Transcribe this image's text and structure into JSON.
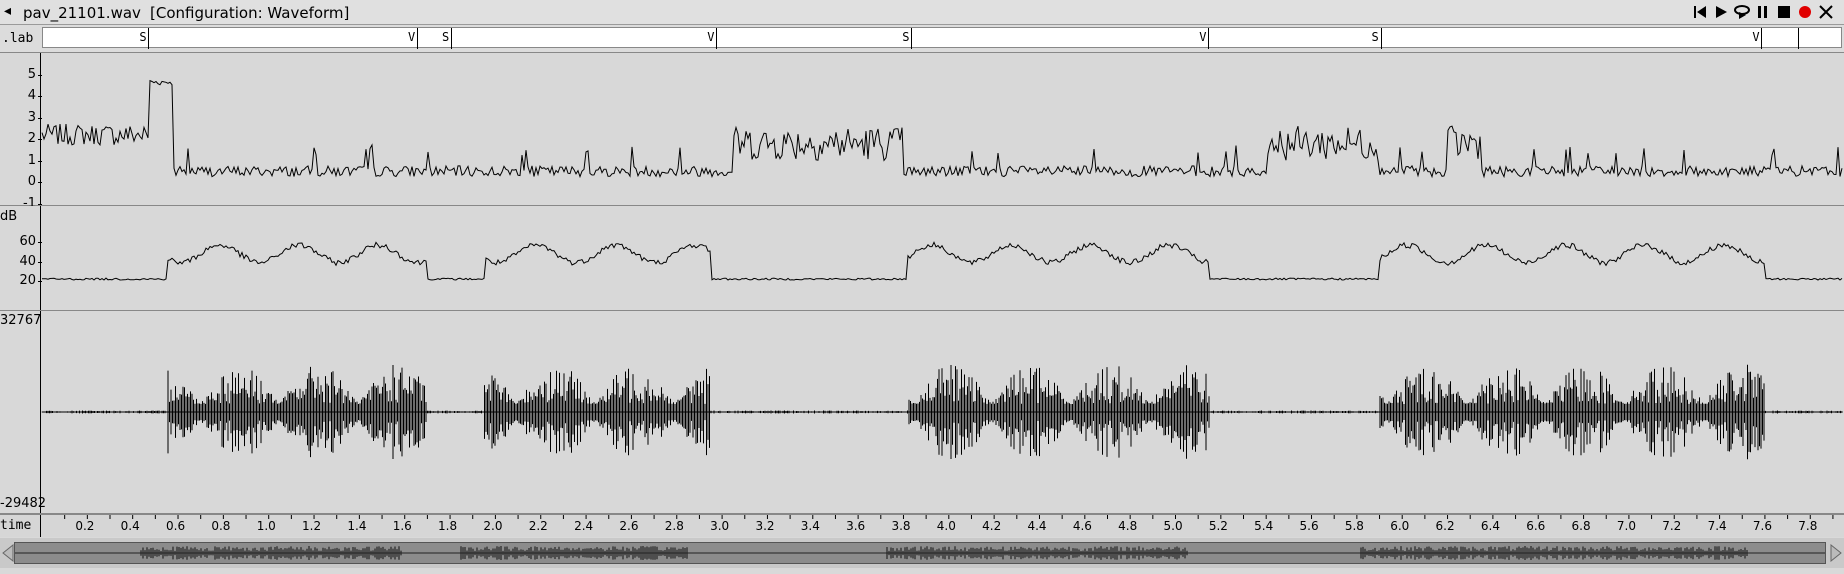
{
  "window": {
    "filename": "pav_21101.wav",
    "configuration": "[Configuration: Waveform]"
  },
  "toolbar": {
    "buttons": [
      "skip-to-start-icon",
      "play-icon",
      "loop-play-icon",
      "pause-icon",
      "stop-icon",
      "record-icon",
      "close-icon"
    ],
    "record_color": "#e00000"
  },
  "label_tier": {
    "name": ".lab",
    "labels": [
      {
        "text": "S",
        "time": 0.465
      },
      {
        "text": "V",
        "time": 1.65
      },
      {
        "text": "S",
        "time": 1.8
      },
      {
        "text": "V",
        "time": 2.97
      },
      {
        "text": "S",
        "time": 3.83
      },
      {
        "text": "V",
        "time": 5.14
      },
      {
        "text": "S",
        "time": 5.9
      },
      {
        "text": "V",
        "time": 7.58
      },
      {
        "text": "",
        "time": 7.74
      }
    ]
  },
  "pitch_pane": {
    "tick_labels": [
      "5",
      "4",
      "3",
      "2",
      "1",
      "0",
      "-1"
    ],
    "tick_values": [
      5,
      4,
      3,
      2,
      1,
      0,
      -1
    ]
  },
  "energy_pane": {
    "unit": "dB",
    "tick_labels": [
      "60",
      "40",
      "20"
    ],
    "tick_values": [
      60,
      40,
      20
    ]
  },
  "waveform_pane": {
    "max_label": "32767",
    "min_label": "-29482"
  },
  "time_axis": {
    "label": "time",
    "start": 0.0,
    "end": 7.94,
    "tick_labels": [
      "0.2",
      "0.4",
      "0.6",
      "0.8",
      "1.0",
      "1.2",
      "1.4",
      "1.6",
      "1.8",
      "2.0",
      "2.2",
      "2.4",
      "2.6",
      "2.8",
      "3.0",
      "3.2",
      "3.4",
      "3.6",
      "3.8",
      "4.0",
      "4.2",
      "4.4",
      "4.6",
      "4.8",
      "5.0",
      "5.2",
      "5.4",
      "5.6",
      "5.8",
      "6.0",
      "6.2",
      "6.4",
      "6.6",
      "6.8",
      "7.0",
      "7.2",
      "7.4",
      "7.6",
      "7.8"
    ]
  }
}
